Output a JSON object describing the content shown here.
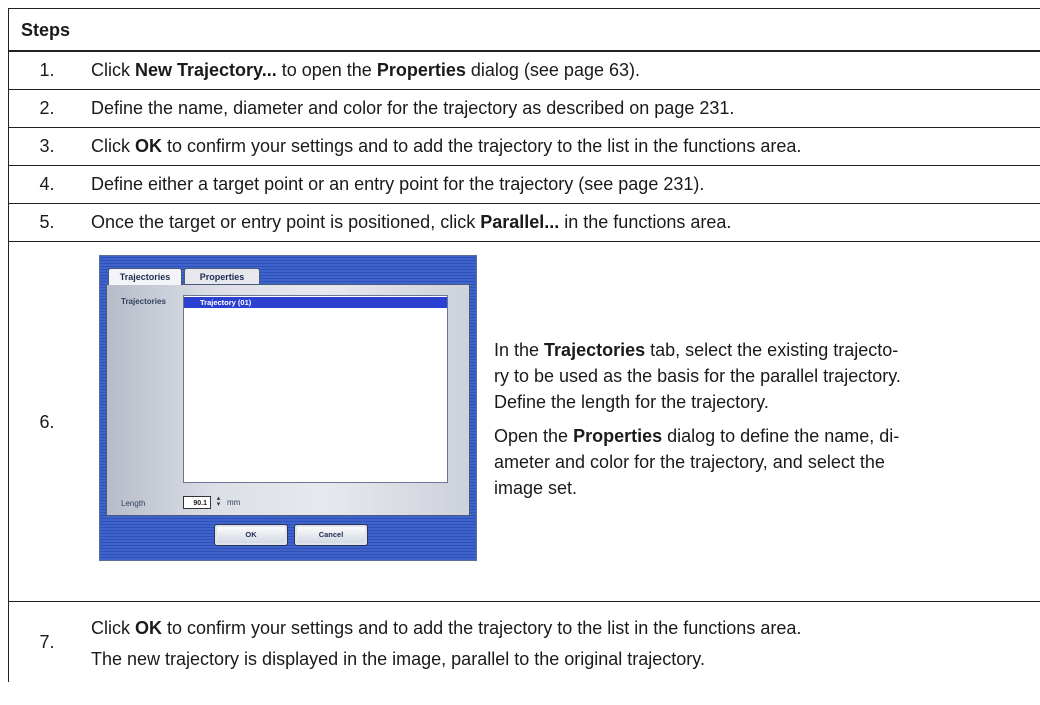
{
  "header": {
    "title": "Steps"
  },
  "steps": {
    "s1": {
      "num": "1.",
      "a": "Click ",
      "b1": "New Trajectory...",
      "c": " to open the ",
      "b2": "Properties",
      "d": " dialog (see page 63)."
    },
    "s2": {
      "num": "2.",
      "text": "Define the name, diameter and color for the trajectory as described on page 231."
    },
    "s3": {
      "num": "3.",
      "a": "Click ",
      "b1": "OK",
      "c": " to confirm your settings and to add the trajectory to the list in the functions area."
    },
    "s4": {
      "num": "4.",
      "text": "Define either a target point or an entry point for the trajectory (see page 231)."
    },
    "s5": {
      "num": "5.",
      "a": "Once the target or entry point is positioned, click ",
      "b1": "Parallel...",
      "c": " in the functions area."
    },
    "s6": {
      "num": "6.",
      "p1": {
        "a": "In the ",
        "b1": "Trajectories",
        "c": " tab, select the existing trajecto-",
        "line2": "ry to be used as the basis for the parallel trajectory.",
        "line3": "Define the length for the trajectory."
      },
      "p2": {
        "a": "Open the ",
        "b1": "Properties",
        "c": " dialog to define the name, di-",
        "line2": "ameter and color for the trajectory, and select the",
        "line3": "image set."
      }
    },
    "s7": {
      "num": "7.",
      "a": "Click ",
      "b1": "OK",
      "c": " to confirm your settings and to add the trajectory to the list in the functions area.",
      "line2": "The new trajectory is displayed in the image, parallel to the original trajectory."
    }
  },
  "dialog": {
    "tabs": [
      "Trajectories",
      "Properties"
    ],
    "list_label": "Trajectories",
    "selected_item": "Trajectory (01)",
    "length_label": "Length",
    "length_value": "90.1",
    "length_unit": "mm",
    "ok_label": "OK",
    "cancel_label": "Cancel",
    "colors": {
      "frame": "#3f63cc",
      "selection": "#2b3fd0"
    }
  }
}
